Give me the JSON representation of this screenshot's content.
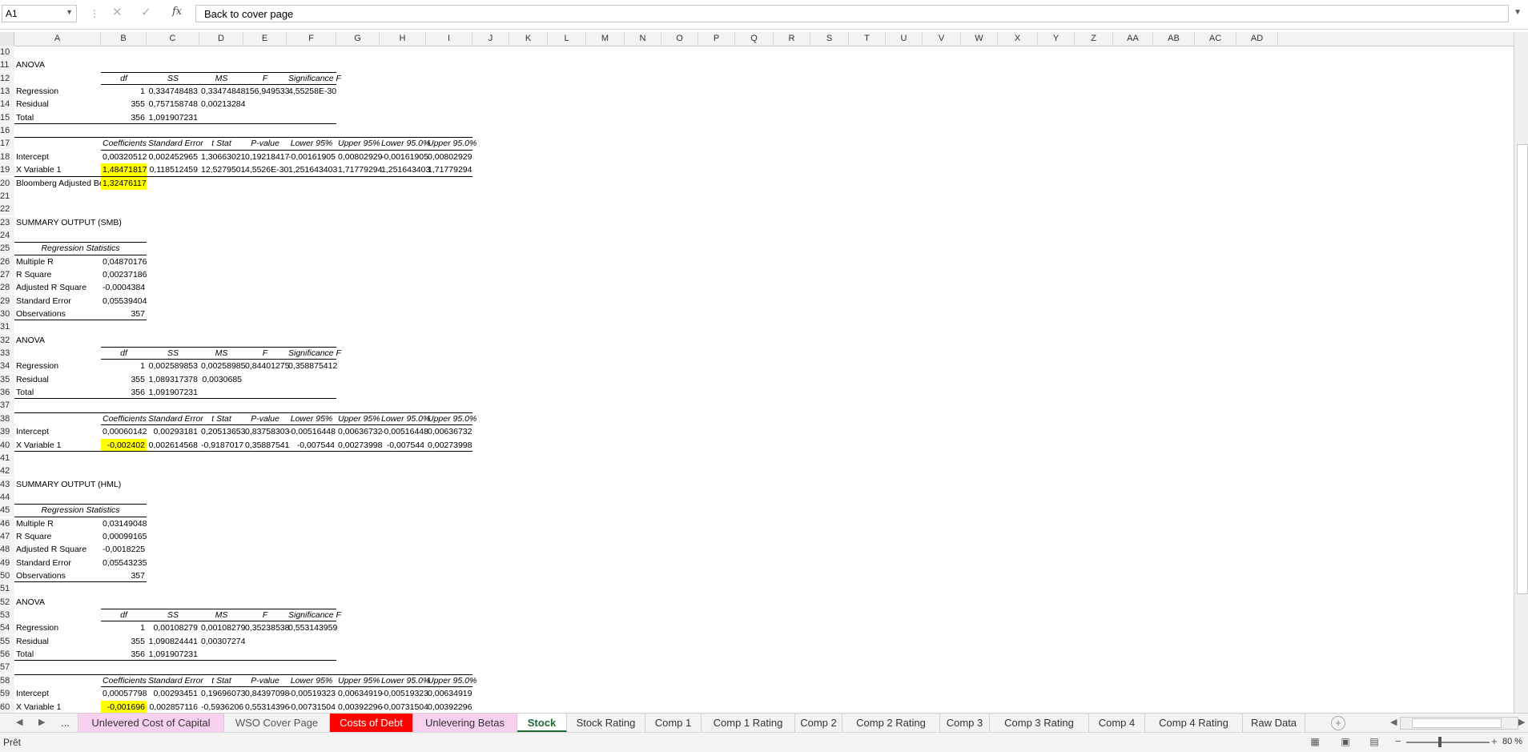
{
  "formula_bar": {
    "name_box": "A1",
    "fx_label": "fx",
    "formula": "Back to cover page",
    "cancel_icon": "close-icon",
    "enter_icon": "check-icon"
  },
  "columns": [
    "A",
    "B",
    "C",
    "D",
    "E",
    "F",
    "G",
    "H",
    "I",
    "J",
    "K",
    "L",
    "M",
    "N",
    "O",
    "P",
    "Q",
    "R",
    "S",
    "T",
    "U",
    "V",
    "W",
    "X",
    "Y",
    "Z",
    "AA",
    "AB",
    "AC",
    "AD"
  ],
  "rows": [
    "10",
    "11",
    "12",
    "13",
    "14",
    "15",
    "16",
    "17",
    "18",
    "19",
    "20",
    "21",
    "22",
    "23",
    "24",
    "25",
    "26",
    "27",
    "28",
    "29",
    "30",
    "31",
    "32",
    "33",
    "34",
    "35",
    "36",
    "37",
    "38",
    "39",
    "40",
    "41",
    "42",
    "43",
    "44",
    "45",
    "46",
    "47",
    "48",
    "49",
    "50",
    "51",
    "52",
    "53",
    "54",
    "55",
    "56",
    "57",
    "58",
    "59",
    "60"
  ],
  "sheet": {
    "anova1": {
      "title": "ANOVA",
      "headers": [
        "df",
        "SS",
        "MS",
        "F",
        "Significance F"
      ],
      "rows": [
        {
          "label": "Regression",
          "df": "1",
          "ss": "0,334748483",
          "ms": "0,33474848",
          "f": "156,949533",
          "sig": "4,55258E-30"
        },
        {
          "label": "Residual",
          "df": "355",
          "ss": "0,757158748",
          "ms": "0,00213284",
          "f": "",
          "sig": ""
        },
        {
          "label": "Total",
          "df": "356",
          "ss": "1,091907231",
          "ms": "",
          "f": "",
          "sig": ""
        }
      ]
    },
    "coef1": {
      "headers": [
        "Coefficients",
        "Standard Error",
        "t Stat",
        "P-value",
        "Lower 95%",
        "Upper 95%",
        "Lower 95.0%",
        "Upper 95.0%"
      ],
      "rows": [
        {
          "label": "Intercept",
          "v": [
            "0,00320512",
            "0,002452965",
            "1,30663021",
            "0,19218417",
            "-0,00161905",
            "0,00802929",
            "-0,00161905",
            "0,00802929"
          ]
        },
        {
          "label": "X Variable 1",
          "v": [
            "1,48471817",
            "0,118512459",
            "12,5279501",
            "4,5526E-30",
            "1,251643403",
            "1,71779294",
            "1,251643403",
            "1,71779294"
          ]
        }
      ],
      "bloomberg_label": "Bloomberg Adjusted Beta",
      "bloomberg_value": "1,32476117"
    },
    "smb": {
      "title": "SUMMARY OUTPUT (SMB)",
      "stats_header": "Regression Statistics",
      "stats": [
        {
          "label": "Multiple R",
          "value": "0,04870176"
        },
        {
          "label": "R Square",
          "value": "0,00237186"
        },
        {
          "label": "Adjusted R Square",
          "value": "-0,0004384"
        },
        {
          "label": "Standard Error",
          "value": "0,05539404"
        },
        {
          "label": "Observations",
          "value": "357"
        }
      ],
      "anova_title": "ANOVA",
      "anova": [
        {
          "label": "Regression",
          "df": "1",
          "ss": "0,002589853",
          "ms": "0,00258985",
          "f": "0,84401275",
          "sig": "0,358875412"
        },
        {
          "label": "Residual",
          "df": "355",
          "ss": "1,089317378",
          "ms": "0,0030685",
          "f": "",
          "sig": ""
        },
        {
          "label": "Total",
          "df": "356",
          "ss": "1,091907231",
          "ms": "",
          "f": "",
          "sig": ""
        }
      ],
      "coef": [
        {
          "label": "Intercept",
          "v": [
            "0,00060142",
            "0,00293181",
            "0,20513653",
            "0,83758303",
            "-0,00516448",
            "0,00636732",
            "-0,00516448",
            "0,00636732"
          ]
        },
        {
          "label": "X Variable 1",
          "v": [
            "-0,002402",
            "0,002614568",
            "-0,9187017",
            "0,35887541",
            "-0,007544",
            "0,00273998",
            "-0,007544",
            "0,00273998"
          ]
        }
      ]
    },
    "hml": {
      "title": "SUMMARY OUTPUT (HML)",
      "stats_header": "Regression Statistics",
      "stats": [
        {
          "label": "Multiple R",
          "value": "0,03149048"
        },
        {
          "label": "R Square",
          "value": "0,00099165"
        },
        {
          "label": "Adjusted R Square",
          "value": "-0,0018225"
        },
        {
          "label": "Standard Error",
          "value": "0,05543235"
        },
        {
          "label": "Observations",
          "value": "357"
        }
      ],
      "anova_title": "ANOVA",
      "anova": [
        {
          "label": "Regression",
          "df": "1",
          "ss": "0,00108279",
          "ms": "0,00108279",
          "f": "0,35238538",
          "sig": "0,553143959"
        },
        {
          "label": "Residual",
          "df": "355",
          "ss": "1,090824441",
          "ms": "0,00307274",
          "f": "",
          "sig": ""
        },
        {
          "label": "Total",
          "df": "356",
          "ss": "1,091907231",
          "ms": "",
          "f": "",
          "sig": ""
        }
      ],
      "coef": [
        {
          "label": "Intercept",
          "v": [
            "0,00057798",
            "0,00293451",
            "0,19696073",
            "0,84397098",
            "-0,00519323",
            "0,00634919",
            "-0,00519323",
            "0,00634919"
          ]
        },
        {
          "label": "X Variable 1",
          "v": [
            "-0,001696",
            "0,002857116",
            "-0,5936206",
            "0,55314396",
            "-0,00731504",
            "0,00392296",
            "-0,00731504",
            "0,00392296"
          ]
        }
      ]
    }
  },
  "tabs": [
    {
      "label": "...",
      "bg": "#f3f3f3",
      "color": "#333"
    },
    {
      "label": "Unlevered Cost of Capital",
      "bg": "#f8d0f0",
      "color": "#333"
    },
    {
      "label": "WSO Cover Page",
      "bg": "#f3f3f3",
      "color": "#555"
    },
    {
      "label": "Costs of Debt",
      "bg": "#ff0000",
      "color": "#ffffff"
    },
    {
      "label": "Unlevering Betas",
      "bg": "#f8d0f0",
      "color": "#333"
    },
    {
      "label": "Stock",
      "bg": "#ffffff",
      "color": "#1e6b35",
      "active": true
    },
    {
      "label": "Stock Rating",
      "bg": "#f3f3f3",
      "color": "#333"
    },
    {
      "label": "Comp 1",
      "bg": "#f3f3f3",
      "color": "#333"
    },
    {
      "label": "Comp 1 Rating",
      "bg": "#f3f3f3",
      "color": "#333"
    },
    {
      "label": "Comp 2",
      "bg": "#f3f3f3",
      "color": "#333"
    },
    {
      "label": "Comp 2 Rating",
      "bg": "#f3f3f3",
      "color": "#333"
    },
    {
      "label": "Comp 3",
      "bg": "#f3f3f3",
      "color": "#333"
    },
    {
      "label": "Comp 3 Rating",
      "bg": "#f3f3f3",
      "color": "#333"
    },
    {
      "label": "Comp 4",
      "bg": "#f3f3f3",
      "color": "#333"
    },
    {
      "label": "Comp 4 Rating",
      "bg": "#f3f3f3",
      "color": "#333"
    },
    {
      "label": "Raw Data",
      "bg": "#f3f3f3",
      "color": "#333"
    }
  ],
  "status": {
    "text": "Prêt",
    "zoom": "80 %"
  },
  "colors": {
    "highlight": "#ffff00",
    "active_tab": "#1e6b35"
  }
}
